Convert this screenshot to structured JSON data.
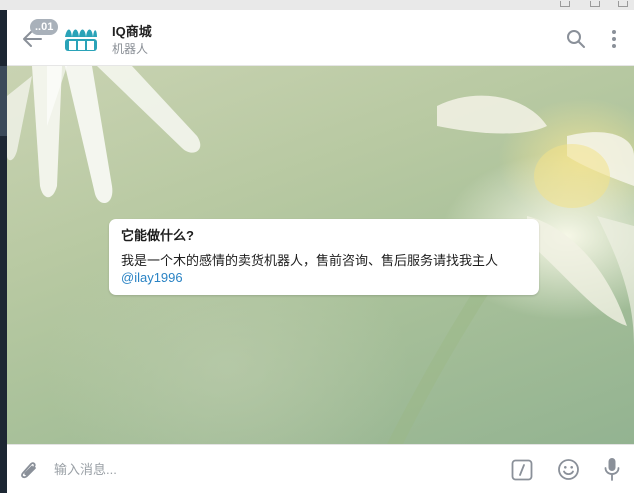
{
  "header": {
    "unread_count": "..01",
    "title": "IQ商城",
    "subtitle": "机器人"
  },
  "message": {
    "title": "它能做什么?",
    "text": "我是一个木的感情的卖货机器人，售前咨询、售后服务请找我主人",
    "link": "@ilay1996"
  },
  "composer": {
    "placeholder": "输入消息..."
  },
  "colors": {
    "link": "#2a83c4",
    "avatar_accent": "#2aa3b8",
    "icon_gray": "#8a9099"
  },
  "icons": [
    "back-arrow-icon",
    "search-icon",
    "more-vertical-icon",
    "paperclip-icon",
    "bot-command-icon",
    "emoji-icon",
    "microphone-icon"
  ]
}
